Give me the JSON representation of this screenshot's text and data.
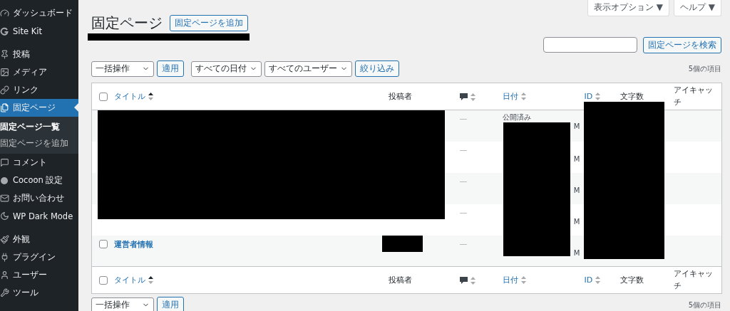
{
  "sidebar": {
    "groups": [
      {
        "items": [
          {
            "label": "ダッシュボード",
            "selected": false
          },
          {
            "label": "Site Kit",
            "selected": false
          }
        ]
      },
      {
        "items": [
          {
            "label": "投稿",
            "selected": false
          },
          {
            "label": "メディア",
            "selected": false
          },
          {
            "label": "リンク",
            "selected": false
          },
          {
            "label": "固定ページ",
            "selected": true,
            "children": [
              {
                "label": "固定ページ一覧",
                "selected": true
              },
              {
                "label": "固定ページを追加",
                "selected": false
              }
            ]
          },
          {
            "label": "コメント",
            "selected": false
          },
          {
            "label": "Cocoon 設定",
            "selected": false
          },
          {
            "label": "お問い合わせ",
            "selected": false
          },
          {
            "label": "WP Dark Mode",
            "selected": false
          }
        ]
      },
      {
        "items": [
          {
            "label": "外観",
            "selected": false
          },
          {
            "label": "プラグイン",
            "selected": false
          },
          {
            "label": "ユーザー",
            "selected": false
          },
          {
            "label": "ツール",
            "selected": false
          }
        ]
      }
    ]
  },
  "screen_tabs": [
    "表示オプション ▼",
    "ヘルプ ▼"
  ],
  "page_title": "固定ページ",
  "add_button": "固定ページを追加",
  "search_button": "固定ページを検索",
  "top_filters": {
    "bulk_action": "一括操作",
    "apply": "適用",
    "date_filter": "すべての日付",
    "user_filter": "すべてのユーザー",
    "filter_button": "絞り込み",
    "item_count": "5個の項目"
  },
  "table": {
    "header_checked": false,
    "header_columns": [
      {
        "label": "タイトル",
        "kind": "sortable"
      },
      {
        "label": "投稿者",
        "kind": "plain"
      },
      {
        "kind": "comment"
      },
      {
        "label": "日付",
        "kind": "sortable"
      },
      {
        "label": "ID",
        "kind": "sortable"
      },
      {
        "label": "文字数",
        "kind": "plain"
      },
      {
        "label": "アイキャッチ",
        "kind": "plain"
      }
    ],
    "rows": [
      {
        "comments": "—",
        "date_status": "公開済み",
        "date_tail": "M"
      },
      {
        "comments": "—",
        "date_tail": "M"
      },
      {
        "comments": "—",
        "date_tail": "M"
      },
      {
        "comments": "—",
        "date_tail": "M"
      },
      {
        "checked": false,
        "title": "運営者情報",
        "comments": "—",
        "date_tail": "M"
      }
    ],
    "footer_checked": false,
    "footer_columns": [
      {
        "label": "タイトル",
        "kind": "sortable"
      },
      {
        "label": "投稿者",
        "kind": "plain"
      },
      {
        "kind": "comment"
      },
      {
        "label": "日付",
        "kind": "sortable"
      },
      {
        "label": "ID",
        "kind": "sortable"
      },
      {
        "label": "文字数",
        "kind": "plain"
      },
      {
        "label": "アイキャッチ",
        "kind": "plain"
      }
    ]
  },
  "bottom_filters": {
    "bulk_action": "一括操作",
    "apply": "適用",
    "item_count": "5個の項目"
  }
}
